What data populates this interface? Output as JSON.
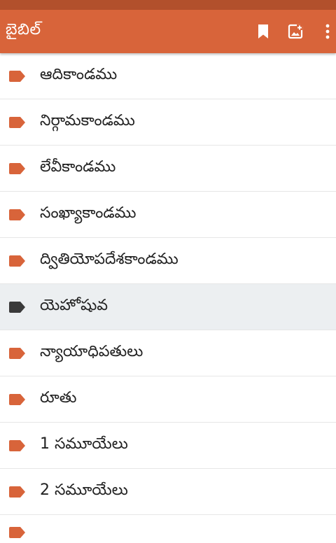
{
  "appbar": {
    "title": "బైబిల్",
    "actions": [
      {
        "icon": "bookmark-icon"
      },
      {
        "icon": "image-add-icon"
      },
      {
        "icon": "more-vert-icon"
      }
    ]
  },
  "colors": {
    "appbar": "#d8643a",
    "statusbar": "#b2502c",
    "tag": "#d8643a",
    "tag_selected": "#3a3a3a",
    "selected_row": "#eceff1"
  },
  "books": [
    {
      "label": "ఆదికాండము",
      "selected": false
    },
    {
      "label": "నిర్గామకాండము",
      "selected": false
    },
    {
      "label": "లేవీకాండము",
      "selected": false
    },
    {
      "label": "సంఖ్యాకాండము",
      "selected": false
    },
    {
      "label": "ద్వితియోపదేశకాండము",
      "selected": false
    },
    {
      "label": "యెహోషువ",
      "selected": true
    },
    {
      "label": "న్యాయాధిపతులు",
      "selected": false
    },
    {
      "label": "రూతు",
      "selected": false
    },
    {
      "label": "1 సమూయేలు",
      "selected": false
    },
    {
      "label": "2 సమూయేలు",
      "selected": false
    }
  ]
}
